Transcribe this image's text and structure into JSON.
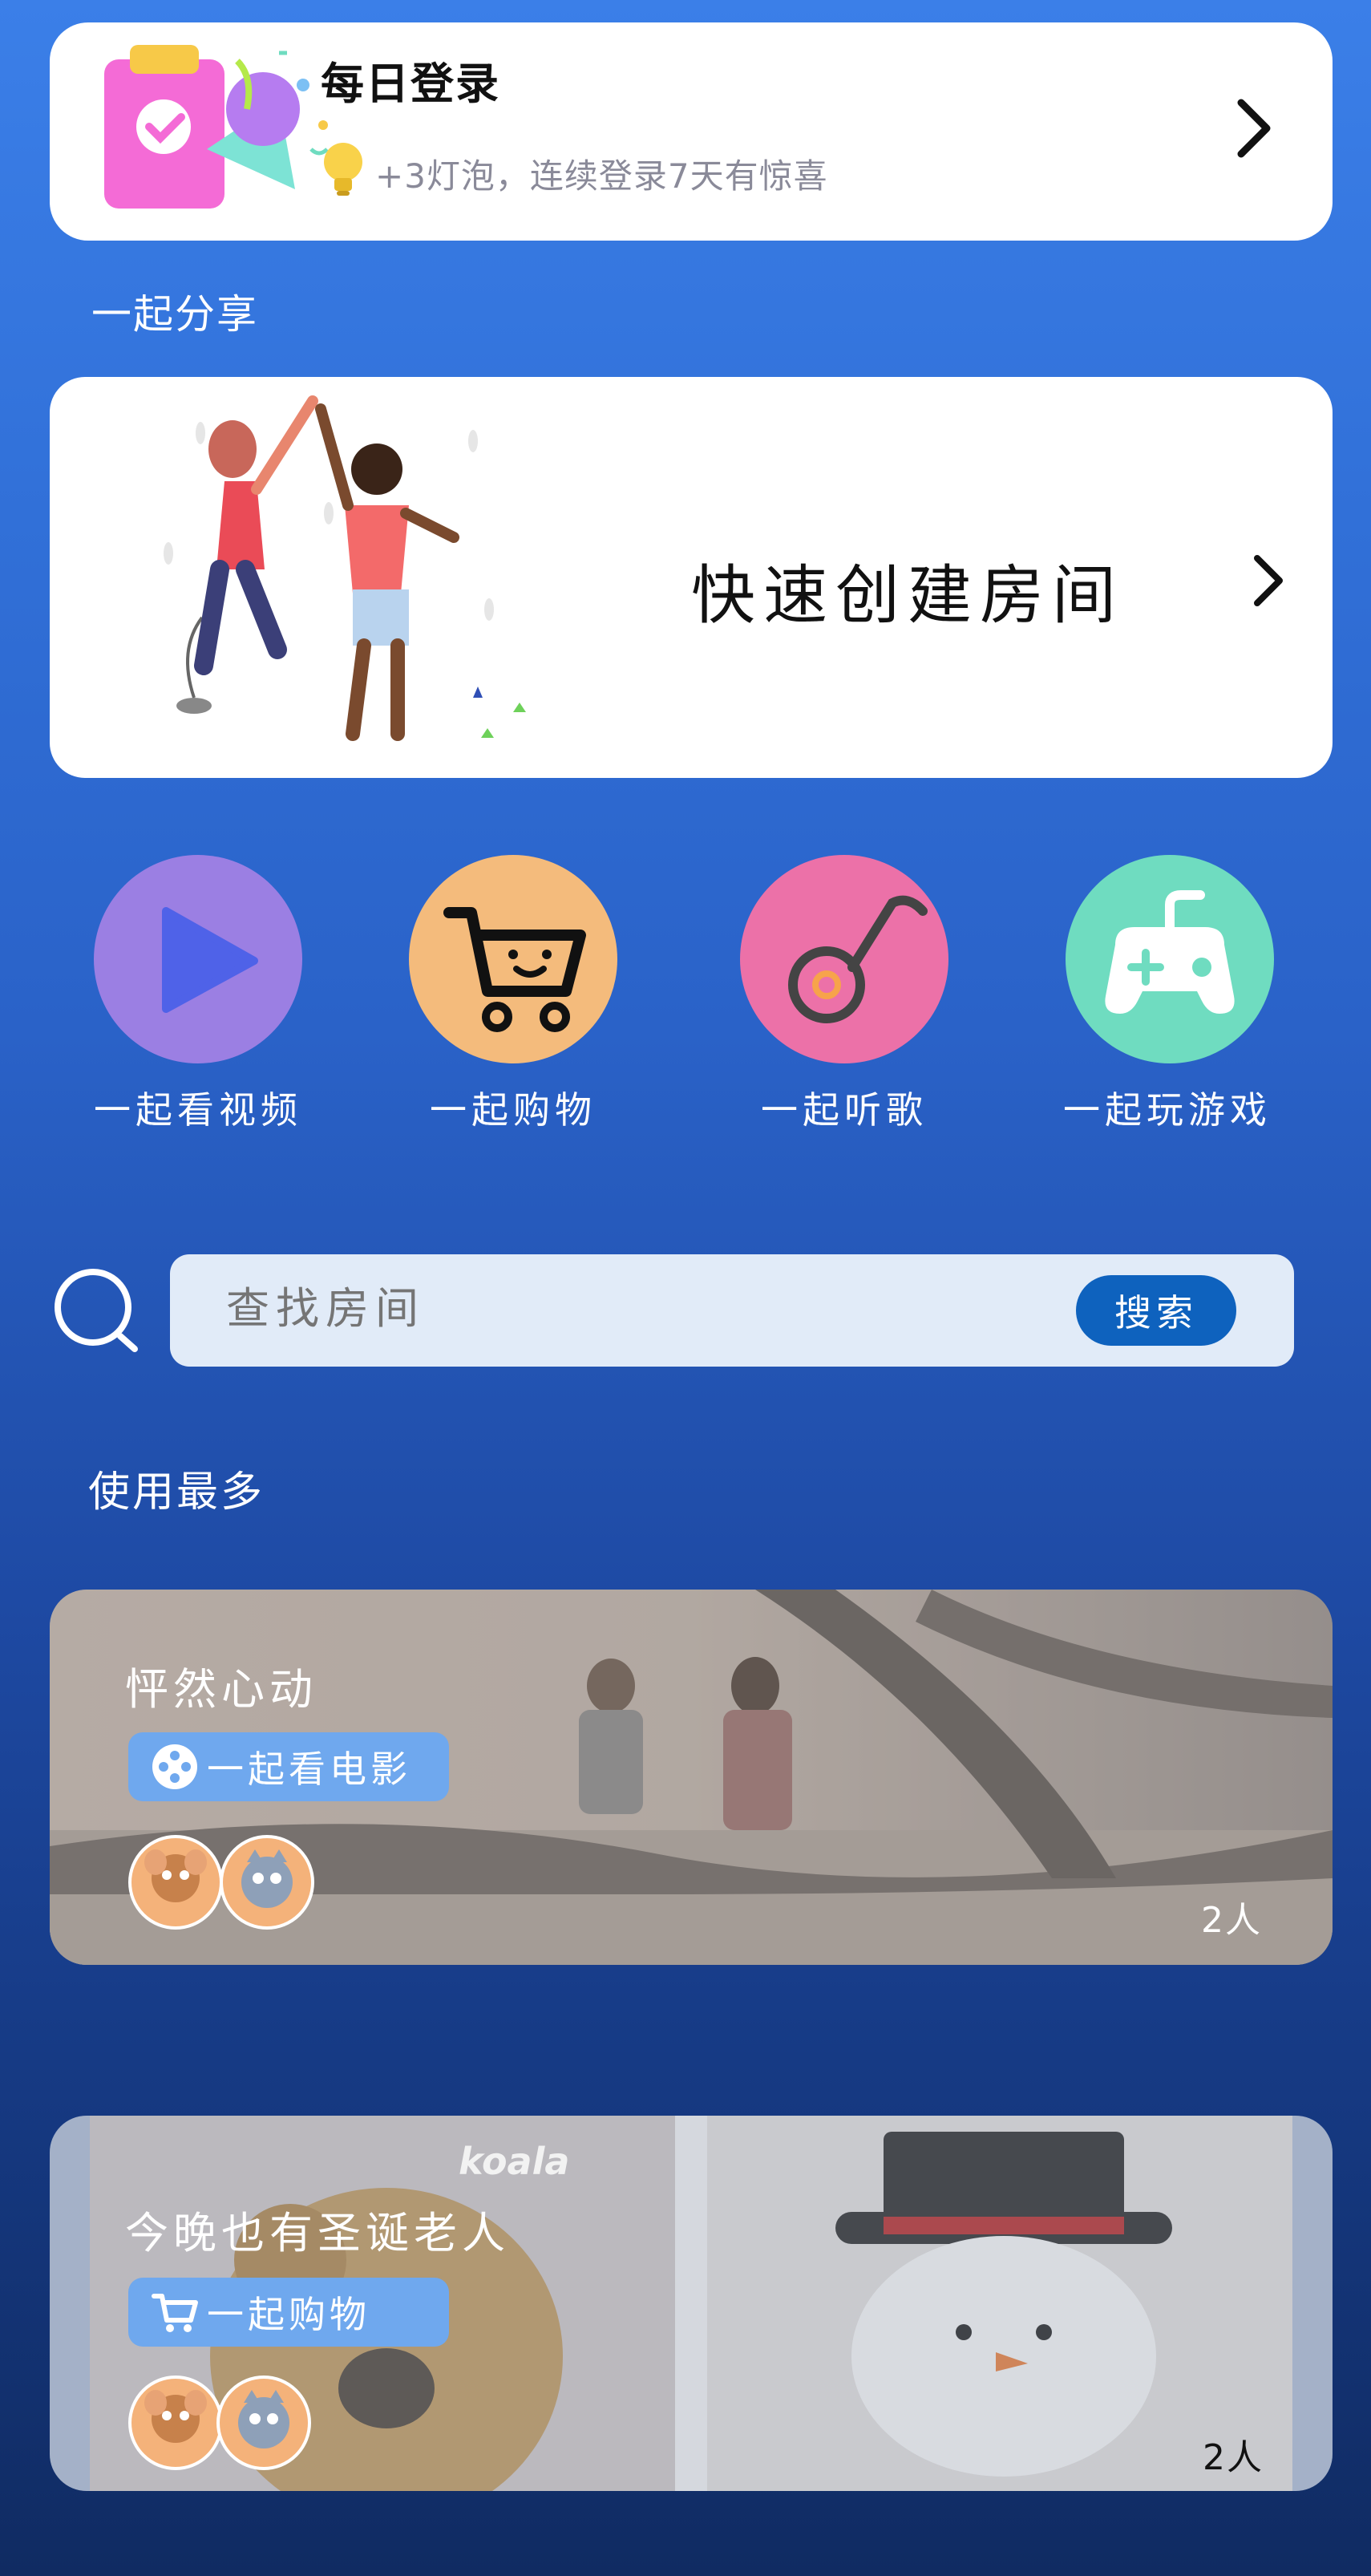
{
  "daily_login": {
    "title": "每日登录",
    "subtitle": "+3灯泡，连续登录7天有惊喜"
  },
  "share": {
    "section_title": "一起分享",
    "create_room_label": "快速创建房间"
  },
  "features": [
    {
      "label": "一起看视频",
      "icon": "play-icon",
      "color": "#9b7fe3"
    },
    {
      "label": "一起购物",
      "icon": "shopping-cart-icon",
      "color": "#f4bb7c"
    },
    {
      "label": "一起听歌",
      "icon": "music-note-icon",
      "color": "#ec71a8"
    },
    {
      "label": "一起玩游戏",
      "icon": "gamepad-icon",
      "color": "#6fdcc0"
    }
  ],
  "search": {
    "placeholder": "查找房间",
    "button_label": "搜索"
  },
  "most_used": {
    "section_title": "使用最多",
    "rooms": [
      {
        "title": "怦然心动",
        "tag": "一起看电影",
        "tag_icon": "film-reel-icon",
        "count": "2人"
      },
      {
        "title": "今晚也有圣诞老人",
        "tag": "一起购物",
        "tag_icon": "shopping-cart-icon",
        "count": "2人",
        "watermark": "koala"
      }
    ]
  },
  "colors": {
    "accent": "#0e62be",
    "tag": "#6fa8ee",
    "search_bg": "#e1ebf8"
  }
}
